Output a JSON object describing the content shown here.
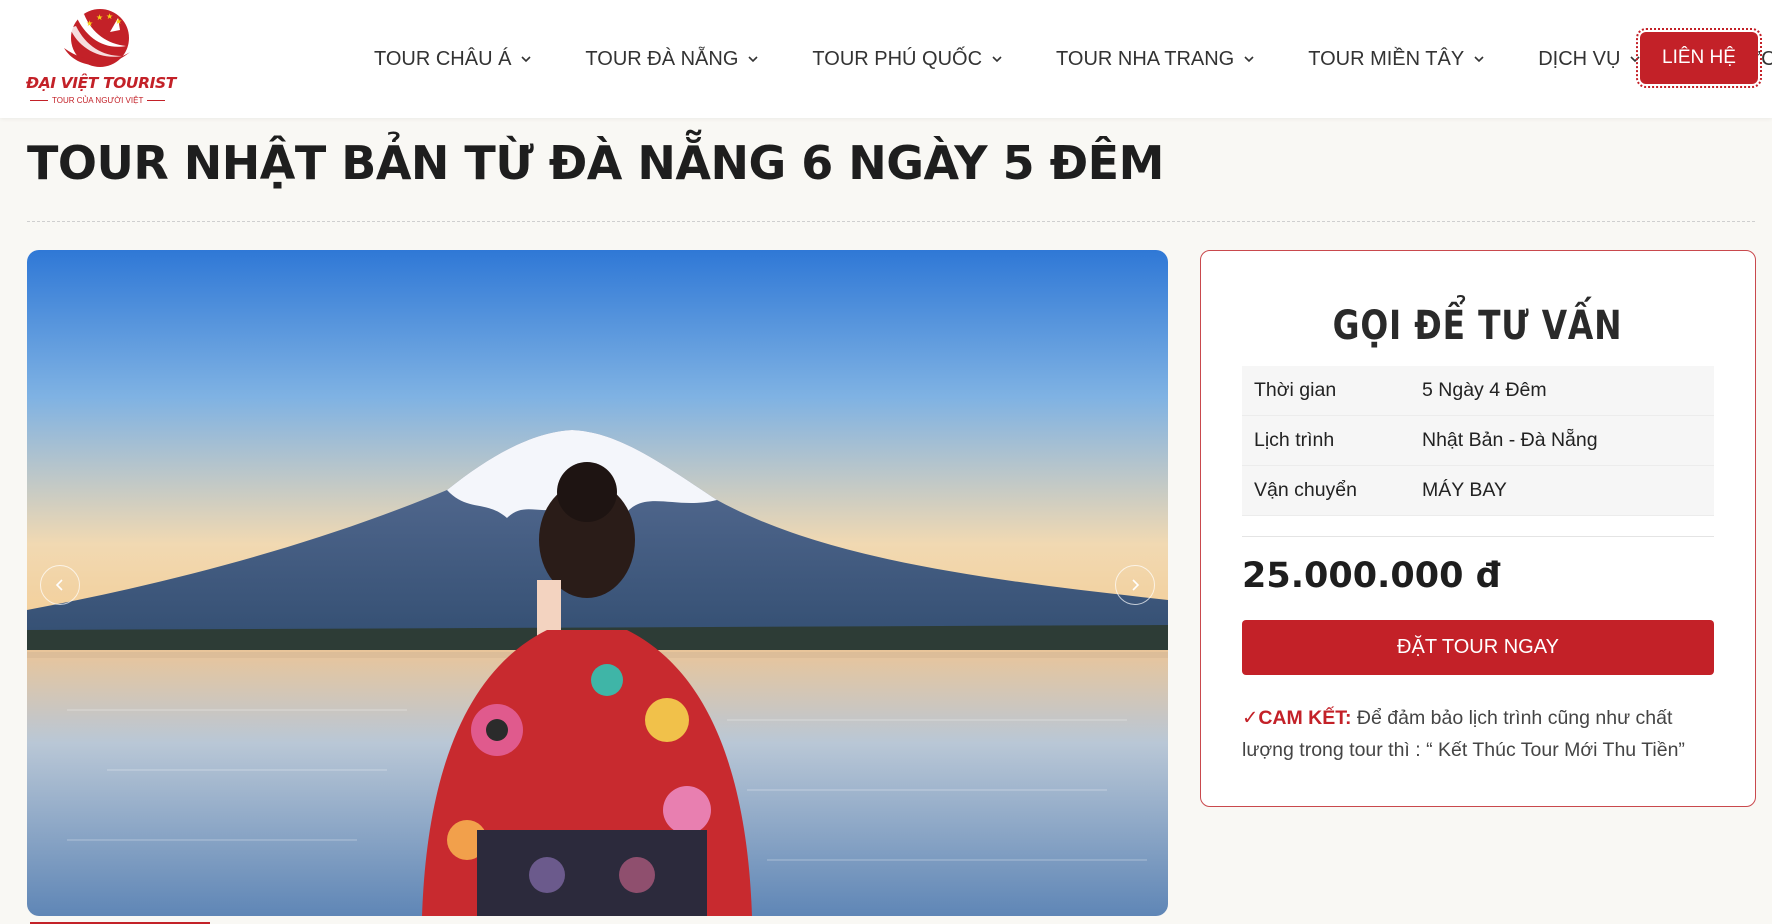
{
  "header": {
    "logo": {
      "name": "ĐẠI VIỆT TOURIST",
      "tagline": "TOUR CỦA NGƯỜI VIỆT"
    },
    "nav": [
      {
        "label": "TOUR CHÂU Á"
      },
      {
        "label": "TOUR ĐÀ NẴNG"
      },
      {
        "label": "TOUR PHÚ QUỐC"
      },
      {
        "label": "TOUR NHA TRANG"
      },
      {
        "label": "TOUR MIỀN TÂY"
      },
      {
        "label": "DỊCH VỤ"
      },
      {
        "label": "TIN TỨC"
      }
    ],
    "contact_label": "LIÊN HỆ"
  },
  "page": {
    "title": "TOUR NHẬT BẢN TỪ ĐÀ NẴNG 6 NGÀY 5 ĐÊM"
  },
  "booking": {
    "title": "GỌI ĐỂ TƯ VẤN",
    "rows": [
      {
        "key": "Thời gian",
        "value": "5 Ngày 4 Đêm"
      },
      {
        "key": "Lịch trình",
        "value": "Nhật Bản - Đà Nẵng"
      },
      {
        "key": "Vận chuyển",
        "value": "MÁY BAY"
      }
    ],
    "price": "25.000.000 đ",
    "book_label": "ĐẶT TOUR NGAY",
    "commit_tick": "✓",
    "commit_label": "CAM KẾT:",
    "commit_text": " Để đảm bảo lịch trình cũng như chất lượng trong tour thì : “ Kết Thúc Tour Mới Thu Tiền”"
  },
  "colors": {
    "brand": "#c32128",
    "text": "#222222",
    "background": "#f9f8f4"
  },
  "icons": {
    "dropdown": "chevron-down-icon",
    "prev": "chevron-left-icon",
    "next": "chevron-right-icon"
  }
}
